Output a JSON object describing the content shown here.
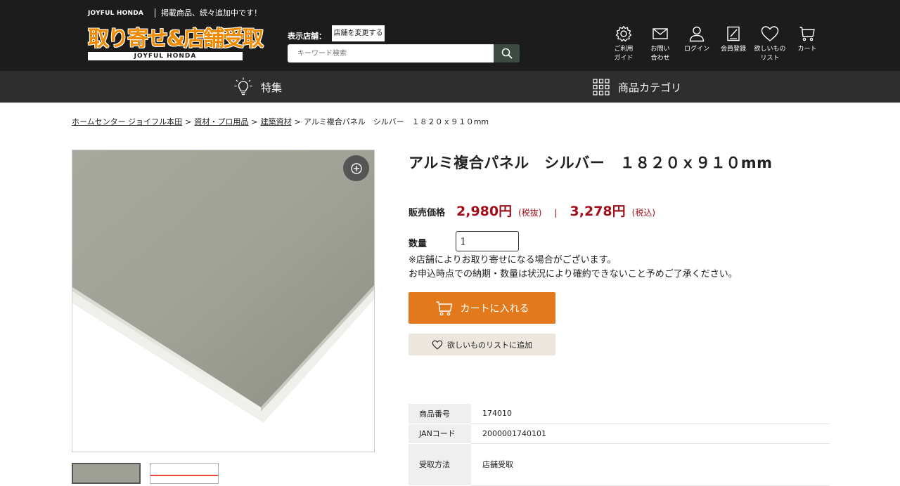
{
  "header": {
    "brand_small": "JOYFUL HONDA",
    "tagline": "掲載商品、続々追加中です！",
    "logo_main": "取り寄せ&店舗受取",
    "logo_sub": "JOYFUL HONDA",
    "store_label": "表示店舗：",
    "store_change": "店舗を変更する",
    "search_placeholder": "キーワード検索",
    "nav": [
      {
        "label": "ご利用\nガイド",
        "icon": "gear-icon"
      },
      {
        "label": "お問い\n合わせ",
        "icon": "mail-icon"
      },
      {
        "label": "ログイン",
        "icon": "user-icon"
      },
      {
        "label": "会員登録",
        "icon": "register-icon"
      },
      {
        "label": "欲しいもの\nリスト",
        "icon": "heart-icon"
      },
      {
        "label": "カート",
        "icon": "cart-icon"
      }
    ]
  },
  "navbar": {
    "feature": "特集",
    "category": "商品カテゴリ"
  },
  "breadcrumb": {
    "items": [
      "ホームセンター ジョイフル本田",
      "資材・プロ用品",
      "建築資材"
    ],
    "current": "アルミ複合パネル　シルバー　１８２０ｘ９１０mm",
    "separator": ">"
  },
  "product": {
    "title": "アルミ複合パネル　シルバー　１８２０ｘ９１０mm",
    "price_label": "販売価格",
    "price_ex": "2,980円",
    "tax_ex": "(税抜)",
    "divider": "|",
    "price_in": "3,278円",
    "tax_in": "(税込)",
    "qty_label": "数量",
    "qty_value": "1",
    "note_1": "※店舗によりお取り寄せになる場合がございます。",
    "note_2": "お申込時点での納期・数量は状況により確約できないこと予めご了承ください。",
    "cart_button": "カートに入れる",
    "wish_button": "欲しいものリストに追加"
  },
  "spec": [
    {
      "label": "商品番号",
      "value": "174010"
    },
    {
      "label": "JANコード",
      "value": "2000001740101"
    },
    {
      "label": "受取方法",
      "value": "店舗受取"
    }
  ],
  "colors": {
    "header_bg": "#1c1c1c",
    "navbar_bg": "#2e2e2e",
    "accent_orange": "#e27a1d",
    "price_red": "#a0101a"
  }
}
